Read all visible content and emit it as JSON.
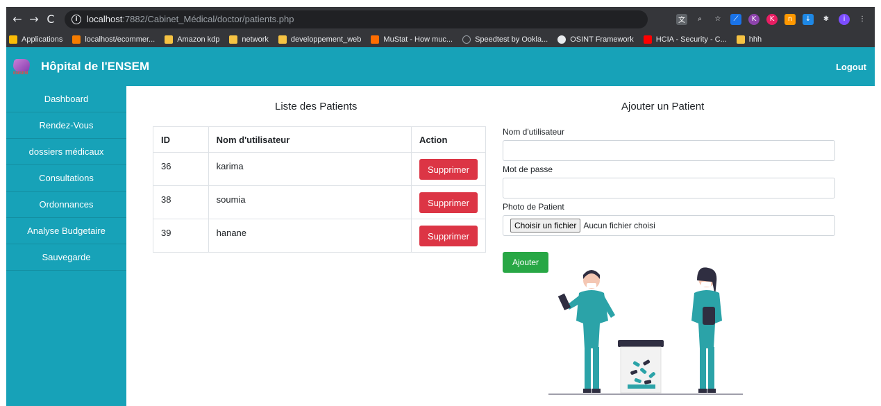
{
  "browser": {
    "url_host": "localhost",
    "url_path": ":7882/Cabinet_Médical/doctor/patients.php",
    "bookmarks": [
      {
        "label": "Applications"
      },
      {
        "label": "localhost/ecommer..."
      },
      {
        "label": "Amazon kdp"
      },
      {
        "label": "network"
      },
      {
        "label": "developpement_web"
      },
      {
        "label": "MuStat - How muc..."
      },
      {
        "label": "Speedtest by Ookla..."
      },
      {
        "label": "OSINT Framework"
      },
      {
        "label": "HCIA - Security - C..."
      },
      {
        "label": "hhh"
      }
    ]
  },
  "navbar": {
    "logo_text": "ENSEM",
    "brand": "Hôpital de l'ENSEM",
    "logout": "Logout"
  },
  "sidebar": {
    "items": [
      {
        "label": "Dashboard"
      },
      {
        "label": "Rendez-Vous"
      },
      {
        "label": "dossiers médicaux"
      },
      {
        "label": "Consultations"
      },
      {
        "label": "Ordonnances"
      },
      {
        "label": "Analyse Budgetaire"
      },
      {
        "label": "Sauvegarde"
      }
    ]
  },
  "list": {
    "title": "Liste des Patients",
    "columns": [
      "ID",
      "Nom d'utilisateur",
      "Action"
    ],
    "rows": [
      {
        "id": "36",
        "name": "karima",
        "action": "Supprimer"
      },
      {
        "id": "38",
        "name": "soumia",
        "action": "Supprimer"
      },
      {
        "id": "39",
        "name": "hanane",
        "action": "Supprimer"
      }
    ]
  },
  "form": {
    "title": "Ajouter un Patient",
    "username_label": "Nom d'utilisateur",
    "password_label": "Mot de passe",
    "photo_label": "Photo de Patient",
    "file_button": "Choisir un fichier",
    "file_status": "Aucun fichier choisi",
    "submit": "Ajouter"
  },
  "colors": {
    "primary": "#17a2b8",
    "danger": "#dc3545",
    "success": "#28a745"
  }
}
